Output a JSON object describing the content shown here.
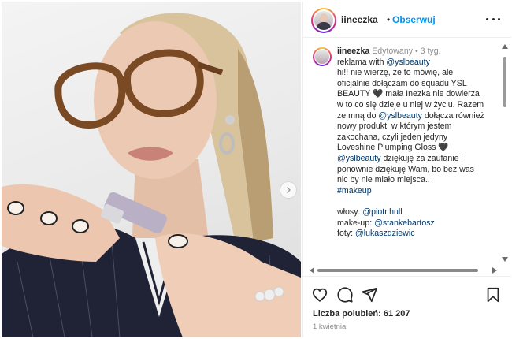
{
  "header": {
    "username": "iineezka",
    "separator": "•",
    "follow_label": "Obserwuj"
  },
  "caption": {
    "username": "iineezka",
    "edited": "Edytowany",
    "separator": "•",
    "age": "3 tyg.",
    "line_1_prefix": "reklama with ",
    "line_1_mention": "@yslbeauty",
    "line_2": "hi!! nie wierzę, że to mówię, ale",
    "line_3": "oficjalnie dołączam do squadu YSL",
    "line_4": "BEAUTY 🖤 mała Inezka nie dowierza",
    "line_5": "w to co się dzieje u niej w życiu. Razem",
    "line_6_prefix": "ze mną do ",
    "line_6_mention": "@yslbeauty",
    "line_6_suffix": " dołącza również",
    "line_7": "nowy produkt, w którym jestem",
    "line_8": "zakochana, czyli jeden jedyny",
    "line_9": "Loveshine Plumping Gloss 🖤",
    "line_10_mention": "@yslbeauty",
    "line_10_suffix": " dziękuję za zaufanie i",
    "line_11": "ponownie dziękuję Wam, bo bez was",
    "line_12": "nic by nie miało miejsca..",
    "line_13_tag": "#makeup",
    "credit_hair_label": "włosy: ",
    "credit_hair_mention": "@piotr.hull",
    "credit_makeup_label": "make-up: ",
    "credit_makeup_mention": "@stankebartosz",
    "credit_photo_label": "foty: ",
    "credit_photo_mention": "@lukaszdziewic"
  },
  "footer": {
    "likes": "Liczba polubień: 61 207",
    "date": "1 kwietnia"
  },
  "icons": {
    "like": "heart-icon",
    "comment": "comment-icon",
    "share": "share-icon",
    "save": "bookmark-icon",
    "more": "more-icon",
    "next": "chevron-right-icon"
  },
  "colors": {
    "link": "#00376b",
    "follow": "#0095f6",
    "muted": "#8e8e8e"
  }
}
